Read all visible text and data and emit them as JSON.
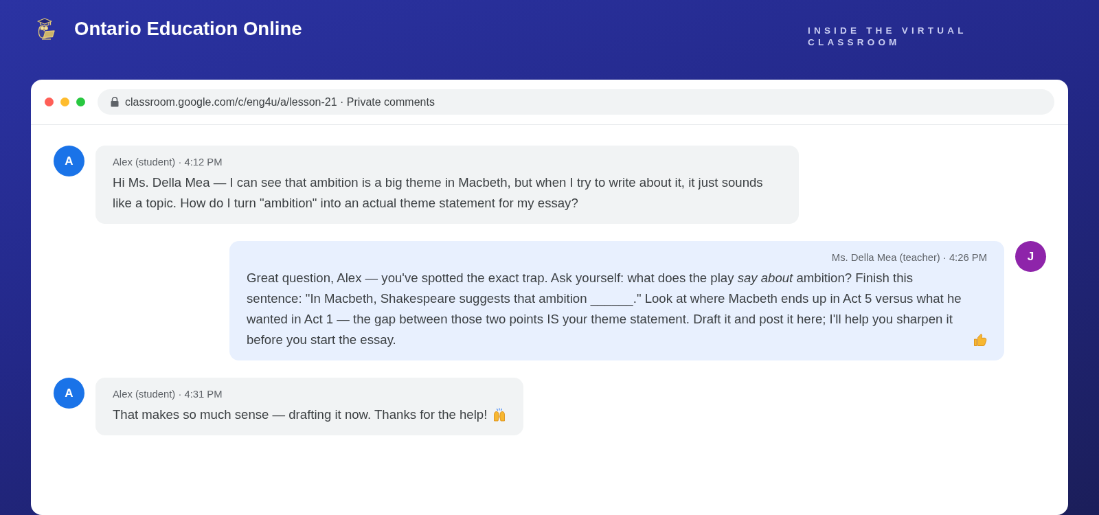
{
  "header": {
    "title": "Ontario Education Online",
    "tagline": "INSIDE THE VIRTUAL CLASSROOM"
  },
  "browser": {
    "url": "classroom.google.com/c/eng4u/a/lesson-21 · Private comments"
  },
  "messages": [
    {
      "kind": "student",
      "avatar": "A",
      "color": "#1a73e8",
      "meta": "Alex (student) · 4:12 PM",
      "text": "Hi Ms. Della Mea — I can see that ambition is a big theme in Macbeth, but when I try to write about it, it just sounds like a topic. How do I turn \"ambition\" into an actual theme statement for my essay?"
    },
    {
      "kind": "teacher",
      "avatar": "J",
      "color": "#8e24aa",
      "meta": "Ms. Della Mea (teacher) · 4:26 PM",
      "text": "Great question, Alex — you've spotted the exact trap. Ask yourself: what does the play *say about* ambition? Finish this sentence: \"In Macbeth, Shakespeare suggests that ambition ______.\" Look at where Macbeth ends up in Act 5 versus what he wanted in Act 1 — the gap between those two points IS your theme statement. Draft it and post it here; I'll help you sharpen it before you start the essay.",
      "end_icon": {
        "kind": "thumbsup"
      }
    },
    {
      "kind": "student",
      "avatar": "A",
      "color": "#1a73e8",
      "meta": "Alex (student) · 4:31 PM",
      "text": "That makes so much sense — drafting it now. Thanks for the help!",
      "end_icon": {
        "kind": "raisedhands"
      }
    }
  ]
}
